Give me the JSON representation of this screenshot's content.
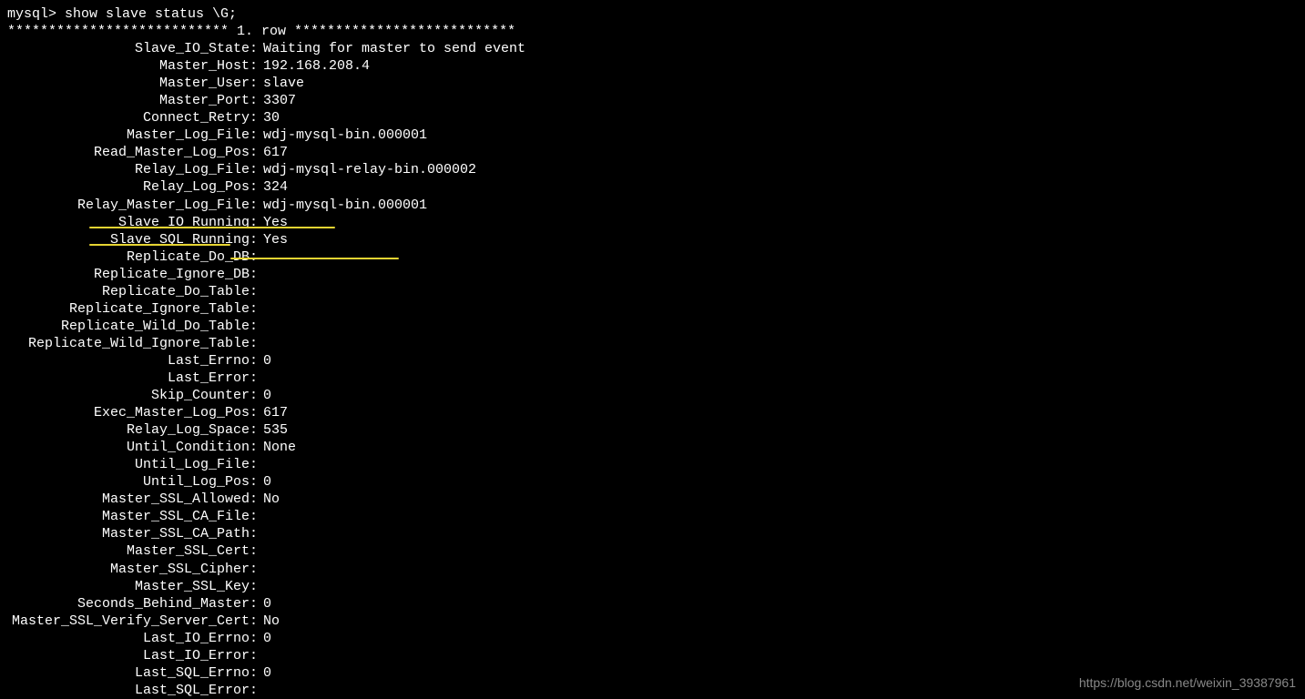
{
  "prompt": "mysql> show slave status \\G;",
  "row_header": "*************************** 1. row ***************************",
  "watermark": "https://blog.csdn.net/weixin_39387961",
  "fields": [
    {
      "label": "Slave_IO_State",
      "value": "Waiting for master to send event"
    },
    {
      "label": "Master_Host",
      "value": "192.168.208.4"
    },
    {
      "label": "Master_User",
      "value": "slave"
    },
    {
      "label": "Master_Port",
      "value": "3307"
    },
    {
      "label": "Connect_Retry",
      "value": "30"
    },
    {
      "label": "Master_Log_File",
      "value": "wdj-mysql-bin.000001"
    },
    {
      "label": "Read_Master_Log_Pos",
      "value": "617"
    },
    {
      "label": "Relay_Log_File",
      "value": "wdj-mysql-relay-bin.000002"
    },
    {
      "label": "Relay_Log_Pos",
      "value": "324"
    },
    {
      "label": "Relay_Master_Log_File",
      "value": "wdj-mysql-bin.000001"
    },
    {
      "label": "Slave_IO_Running",
      "value": "Yes"
    },
    {
      "label": "Slave_SQL_Running",
      "value": "Yes"
    },
    {
      "label": "Replicate_Do_DB",
      "value": ""
    },
    {
      "label": "Replicate_Ignore_DB",
      "value": ""
    },
    {
      "label": "Replicate_Do_Table",
      "value": ""
    },
    {
      "label": "Replicate_Ignore_Table",
      "value": ""
    },
    {
      "label": "Replicate_Wild_Do_Table",
      "value": ""
    },
    {
      "label": "Replicate_Wild_Ignore_Table",
      "value": ""
    },
    {
      "label": "Last_Errno",
      "value": "0"
    },
    {
      "label": "Last_Error",
      "value": ""
    },
    {
      "label": "Skip_Counter",
      "value": "0"
    },
    {
      "label": "Exec_Master_Log_Pos",
      "value": "617"
    },
    {
      "label": "Relay_Log_Space",
      "value": "535"
    },
    {
      "label": "Until_Condition",
      "value": "None"
    },
    {
      "label": "Until_Log_File",
      "value": ""
    },
    {
      "label": "Until_Log_Pos",
      "value": "0"
    },
    {
      "label": "Master_SSL_Allowed",
      "value": "No"
    },
    {
      "label": "Master_SSL_CA_File",
      "value": ""
    },
    {
      "label": "Master_SSL_CA_Path",
      "value": ""
    },
    {
      "label": "Master_SSL_Cert",
      "value": ""
    },
    {
      "label": "Master_SSL_Cipher",
      "value": ""
    },
    {
      "label": "Master_SSL_Key",
      "value": ""
    },
    {
      "label": "Seconds_Behind_Master",
      "value": "0"
    },
    {
      "label": "Master_SSL_Verify_Server_Cert",
      "value": "No"
    },
    {
      "label": "Last_IO_Errno",
      "value": "0"
    },
    {
      "label": "Last_IO_Error",
      "value": ""
    },
    {
      "label": "Last_SQL_Errno",
      "value": "0"
    },
    {
      "label": "Last_SQL_Error",
      "value": ""
    }
  ]
}
